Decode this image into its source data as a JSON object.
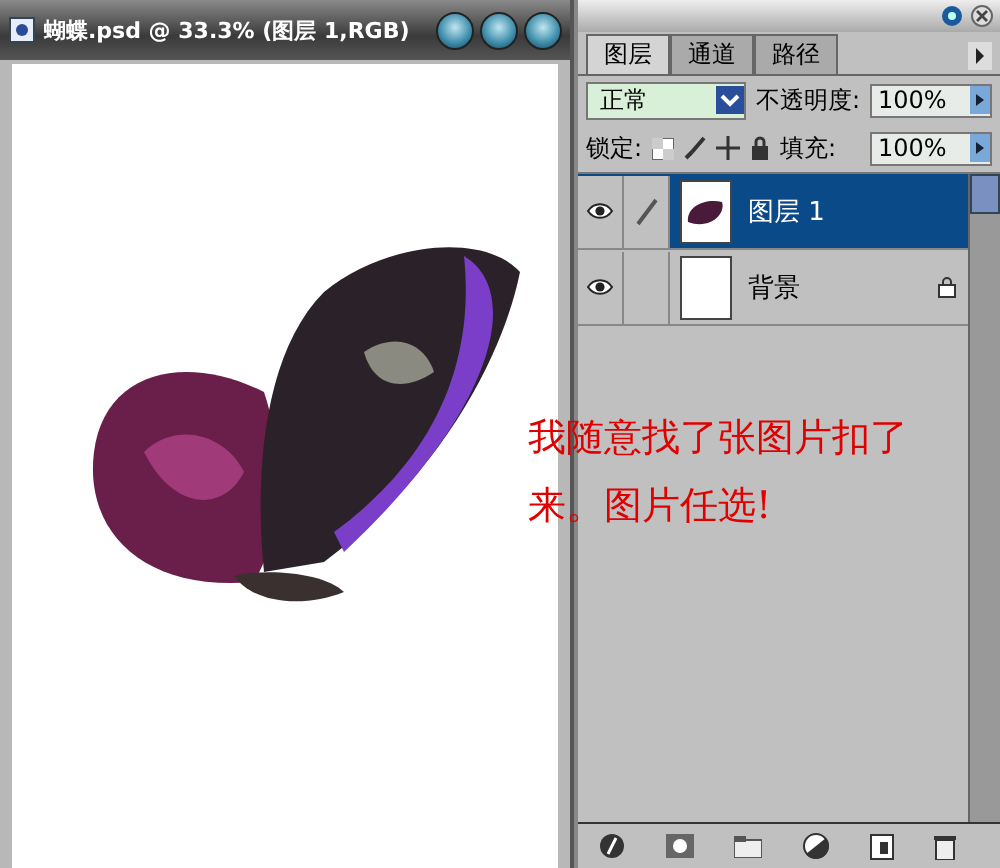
{
  "document": {
    "title": "蝴蝶.psd @ 33.3% (图层 1,RGB)"
  },
  "panel": {
    "tabs": [
      {
        "label": "图层",
        "selected": true
      },
      {
        "label": "通道",
        "selected": false
      },
      {
        "label": "路径",
        "selected": false
      }
    ],
    "blend_mode": "正常",
    "opacity_label": "不透明度:",
    "opacity": "100%",
    "lock_label": "锁定:",
    "fill_label": "填充:",
    "fill": "100%",
    "layers": [
      {
        "name": "图层 1",
        "kind": "image",
        "visible": true,
        "selected": true,
        "editing": true,
        "locked": false
      },
      {
        "name": "背景",
        "kind": "blank",
        "visible": true,
        "selected": false,
        "editing": false,
        "locked": true
      }
    ]
  },
  "annotation": "我随意找了张图片扣了来。图片任选!"
}
